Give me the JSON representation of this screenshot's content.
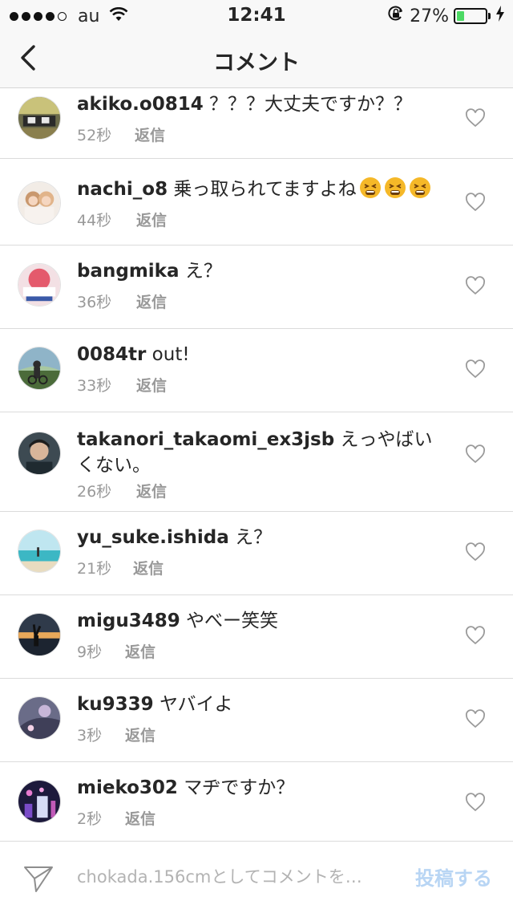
{
  "status_bar": {
    "carrier": "au",
    "time": "12:41",
    "battery_percent": "27%",
    "battery_level": 0.27,
    "battery_color": "#4cd964"
  },
  "nav": {
    "back_icon": "chevron-left-icon",
    "title": "コメント"
  },
  "comments": [
    {
      "username": "akiko.o0814",
      "text": "？？？大丈夫ですか？？",
      "time": "52秒",
      "reply_label": "返信"
    },
    {
      "username": "nachi_o8",
      "text": "乗っ取られてますよね",
      "emoji_count": 3,
      "time": "44秒",
      "reply_label": "返信"
    },
    {
      "username": "bangmika",
      "text": "え？",
      "time": "36秒",
      "reply_label": "返信"
    },
    {
      "username": "0084tr",
      "text": "out!",
      "time": "33秒",
      "reply_label": "返信"
    },
    {
      "username": "takanori_takaomi_ex3jsb",
      "text": "えっやばいくない。",
      "time": "26秒",
      "reply_label": "返信"
    },
    {
      "username": "yu_suke.ishida",
      "text": "え？",
      "time": "21秒",
      "reply_label": "返信"
    },
    {
      "username": "migu3489",
      "text": "やべー笑笑",
      "time": "9秒",
      "reply_label": "返信"
    },
    {
      "username": "ku9339",
      "text": "ヤバイよ",
      "time": "3秒",
      "reply_label": "返信"
    },
    {
      "username": "mieko302",
      "text": "マヂですか？",
      "time": "2秒",
      "reply_label": "返信"
    }
  ],
  "composer": {
    "placeholder": "chokada.156cmとしてコメントを…",
    "post_label": "投稿する",
    "post_color": "#b8d5f4"
  },
  "colors": {
    "text": "#262626",
    "meta": "#999999",
    "divider": "#dbdbdb"
  }
}
